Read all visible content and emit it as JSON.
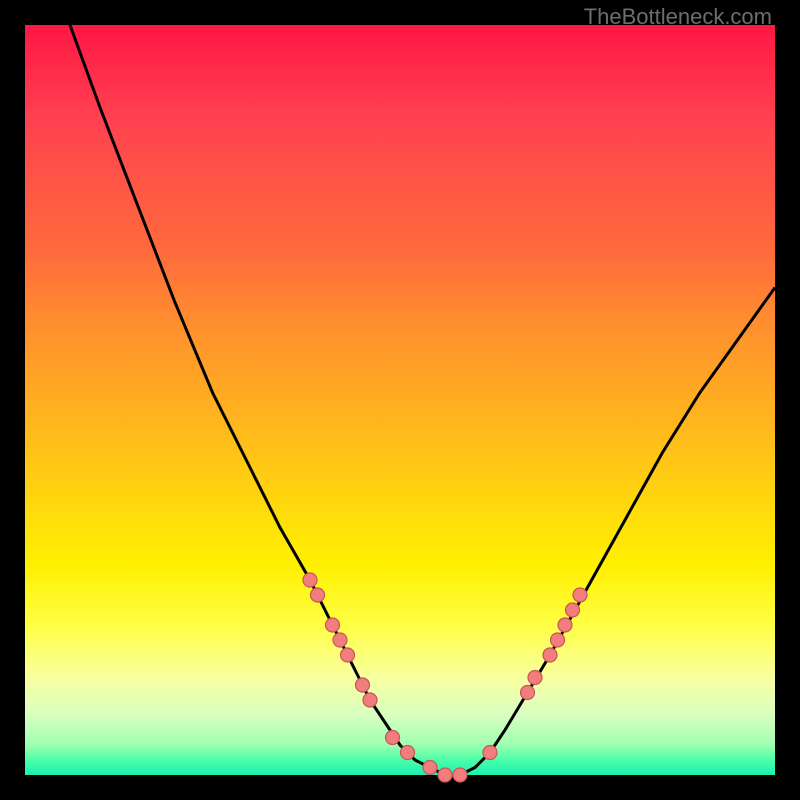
{
  "watermark": "TheBottleneck.com",
  "colors": {
    "frame": "#000000",
    "curve": "#000000",
    "dot_fill": "#f17d7d",
    "dot_stroke": "#c75656",
    "gradient_top": "#ff1744",
    "gradient_bottom": "#1cf0b0"
  },
  "chart_data": {
    "type": "line",
    "title": "",
    "xlabel": "",
    "ylabel": "",
    "xlim": [
      0,
      100
    ],
    "ylim": [
      0,
      100
    ],
    "series": [
      {
        "name": "curve",
        "x": [
          6,
          10,
          15,
          20,
          25,
          30,
          34,
          38,
          41,
          44,
          46,
          48,
          50,
          52,
          54,
          56,
          58,
          60,
          62,
          64,
          67,
          70,
          75,
          80,
          85,
          90,
          95,
          100
        ],
        "y": [
          100,
          89,
          76,
          63,
          51,
          41,
          33,
          26,
          20,
          14,
          10,
          7,
          4,
          2,
          1,
          0,
          0,
          1,
          3,
          6,
          11,
          16,
          25,
          34,
          43,
          51,
          58,
          65
        ]
      }
    ],
    "dots": [
      {
        "x": 38,
        "y": 26
      },
      {
        "x": 39,
        "y": 24
      },
      {
        "x": 41,
        "y": 20
      },
      {
        "x": 42,
        "y": 18
      },
      {
        "x": 43,
        "y": 16
      },
      {
        "x": 45,
        "y": 12
      },
      {
        "x": 46,
        "y": 10
      },
      {
        "x": 49,
        "y": 5
      },
      {
        "x": 51,
        "y": 3
      },
      {
        "x": 54,
        "y": 1
      },
      {
        "x": 56,
        "y": 0
      },
      {
        "x": 58,
        "y": 0
      },
      {
        "x": 62,
        "y": 3
      },
      {
        "x": 67,
        "y": 11
      },
      {
        "x": 68,
        "y": 13
      },
      {
        "x": 70,
        "y": 16
      },
      {
        "x": 71,
        "y": 18
      },
      {
        "x": 72,
        "y": 20
      },
      {
        "x": 73,
        "y": 22
      },
      {
        "x": 74,
        "y": 24
      }
    ]
  }
}
